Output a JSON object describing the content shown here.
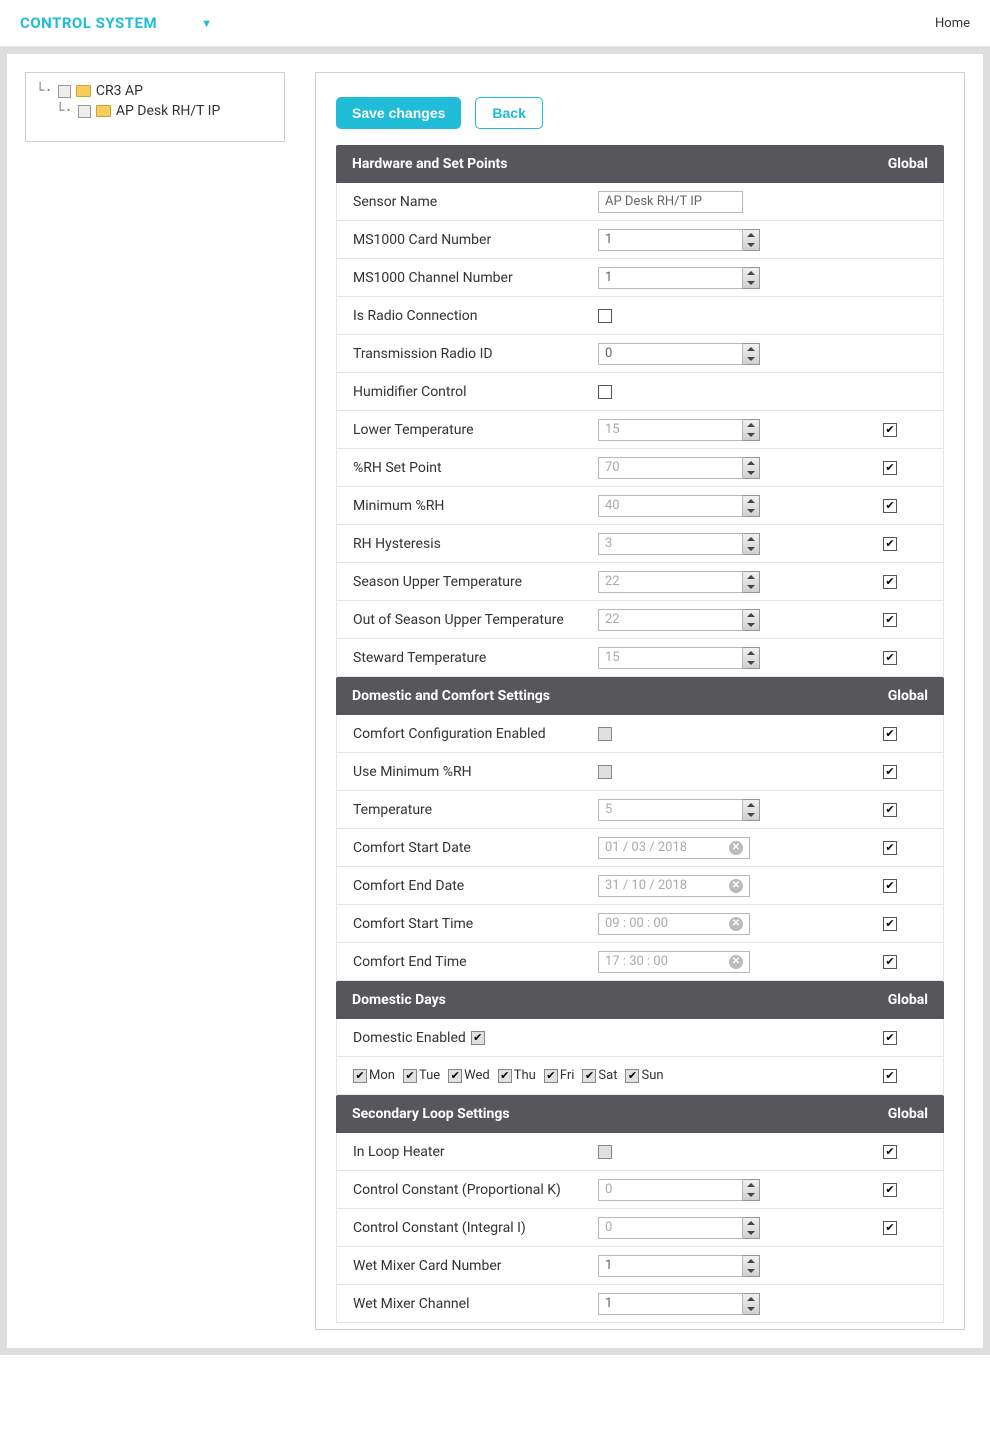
{
  "topbar": {
    "brand": "CONTROL SYSTEM",
    "home": "Home"
  },
  "tree": {
    "root": "CR3 AP",
    "child": "AP Desk RH/T IP"
  },
  "buttons": {
    "save": "Save changes",
    "back": "Back"
  },
  "sections": {
    "hardware": {
      "title": "Hardware and Set Points",
      "global": "Global",
      "rows": {
        "sensor_name": {
          "label": "Sensor Name",
          "value": "AP Desk RH/T IP"
        },
        "card_number": {
          "label": "MS1000 Card Number",
          "value": "1"
        },
        "channel_number": {
          "label": "MS1000 Channel Number",
          "value": "1"
        },
        "is_radio": {
          "label": "Is Radio Connection",
          "checked": false
        },
        "radio_id": {
          "label": "Transmission Radio ID",
          "value": "0"
        },
        "humidifier": {
          "label": "Humidifier Control",
          "checked": false
        },
        "lower_temp": {
          "label": "Lower Temperature",
          "value": "15",
          "global": true
        },
        "rh_set": {
          "label": "%RH Set Point",
          "value": "70",
          "global": true
        },
        "min_rh": {
          "label": "Minimum %RH",
          "value": "40",
          "global": true
        },
        "rh_hyst": {
          "label": "RH Hysteresis",
          "value": "3",
          "global": true
        },
        "season_upper": {
          "label": "Season Upper Temperature",
          "value": "22",
          "global": true
        },
        "out_season_upper": {
          "label": "Out of Season Upper Temperature",
          "value": "22",
          "global": true
        },
        "steward_temp": {
          "label": "Steward Temperature",
          "value": "15",
          "global": true
        }
      }
    },
    "domestic": {
      "title": "Domestic and Comfort Settings",
      "global": "Global",
      "rows": {
        "comfort_enabled": {
          "label": "Comfort Configuration Enabled",
          "checked": false,
          "global": true
        },
        "use_min_rh": {
          "label": "Use Minimum %RH",
          "checked": false,
          "global": true
        },
        "temperature": {
          "label": "Temperature",
          "value": "5",
          "global": true
        },
        "start_date": {
          "label": "Comfort Start Date",
          "value": "01 / 03 / 2018",
          "global": true
        },
        "end_date": {
          "label": "Comfort End Date",
          "value": "31 / 10 / 2018",
          "global": true
        },
        "start_time": {
          "label": "Comfort Start Time",
          "value": "09 : 00 : 00",
          "global": true
        },
        "end_time": {
          "label": "Comfort End Time",
          "value": "17 : 30 : 00",
          "global": true
        }
      }
    },
    "days": {
      "title": "Domestic Days",
      "global": "Global",
      "enabled_label": "Domestic Enabled",
      "enabled_checked": true,
      "enabled_global": true,
      "days": [
        {
          "label": "Mon",
          "checked": true
        },
        {
          "label": "Tue",
          "checked": true
        },
        {
          "label": "Wed",
          "checked": true
        },
        {
          "label": "Thu",
          "checked": true
        },
        {
          "label": "Fri",
          "checked": true
        },
        {
          "label": "Sat",
          "checked": true
        },
        {
          "label": "Sun",
          "checked": true
        }
      ],
      "days_global": true
    },
    "secondary": {
      "title": "Secondary Loop Settings",
      "global": "Global",
      "rows": {
        "in_loop": {
          "label": "In Loop Heater",
          "checked": false,
          "global": true
        },
        "prop_k": {
          "label": "Control Constant (Proportional K)",
          "value": "0",
          "global": true
        },
        "integral_i": {
          "label": "Control Constant (Integral I)",
          "value": "0",
          "global": true
        },
        "wet_card": {
          "label": "Wet Mixer Card Number",
          "value": "1"
        },
        "wet_channel": {
          "label": "Wet Mixer Channel",
          "value": "1"
        }
      }
    }
  }
}
